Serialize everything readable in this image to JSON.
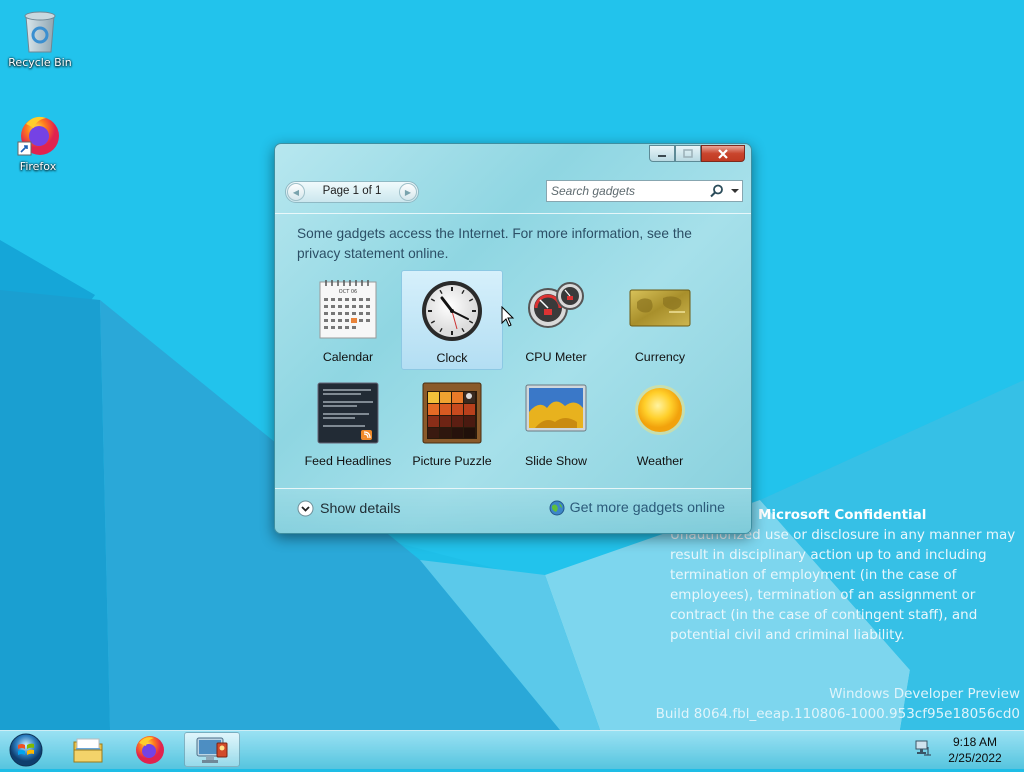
{
  "desktop": {
    "icons": [
      {
        "label": "Recycle Bin"
      },
      {
        "label": "Firefox"
      }
    ],
    "watermark": {
      "title": "Microsoft Confidential",
      "lines": [
        "Unauthorized use or disclosure in any manner may",
        "result in disciplinary action up to and including",
        "termination of employment (in the case of",
        "employees), termination of an assignment or",
        "contract (in the case of contingent staff), and",
        "potential civil and criminal liability."
      ]
    },
    "build": {
      "line1": "Windows Developer Preview",
      "line2": "Build 8064.fbl_eeap.110806-1000.953cf95e18056cd0"
    }
  },
  "gadgets_window": {
    "pager": {
      "label": "Page 1 of 1"
    },
    "search": {
      "placeholder": "Search gadgets"
    },
    "notice": "Some gadgets access the Internet.  For more information, see the privacy statement online.",
    "gadgets": [
      {
        "name": "Calendar",
        "selected": false,
        "calendar_month": "OCT 06"
      },
      {
        "name": "Clock",
        "selected": true
      },
      {
        "name": "CPU Meter",
        "selected": false
      },
      {
        "name": "Currency",
        "selected": false
      },
      {
        "name": "Feed Headlines",
        "selected": false
      },
      {
        "name": "Picture Puzzle",
        "selected": false
      },
      {
        "name": "Slide Show",
        "selected": false
      },
      {
        "name": "Weather",
        "selected": false
      }
    ],
    "footer": {
      "show_details": "Show details",
      "get_more": "Get more gadgets online"
    }
  },
  "taskbar": {
    "clock": {
      "time": "9:18 AM",
      "date": "2/25/2022"
    }
  },
  "colors": {
    "wallpaper": "#1ebde6",
    "close_button": "#c9452d",
    "notice_text": "#2c4f66"
  }
}
